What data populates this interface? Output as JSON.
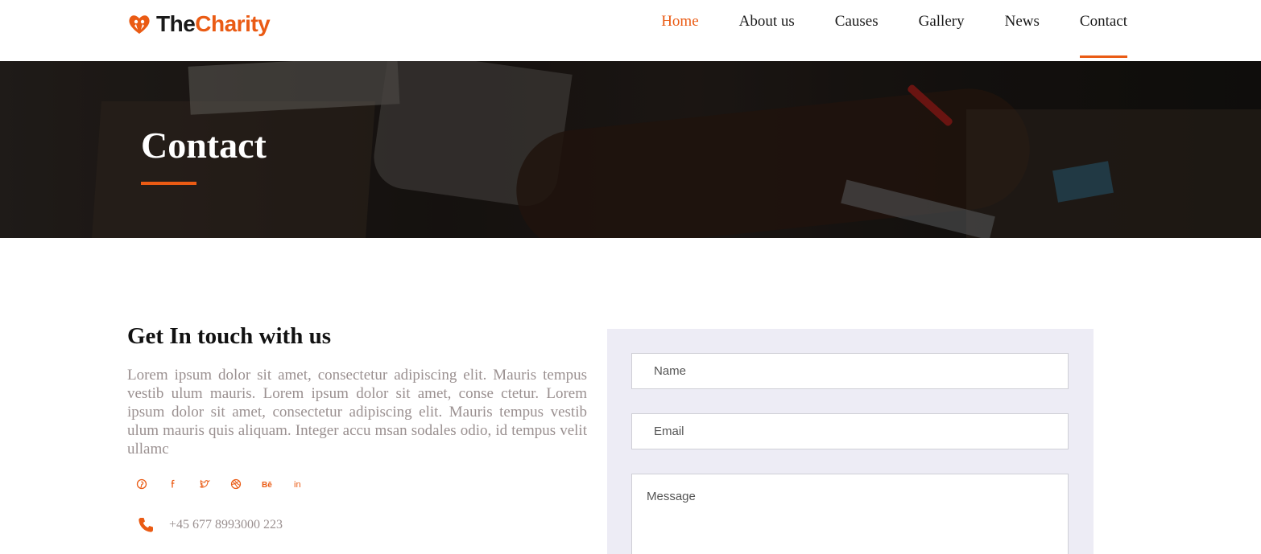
{
  "brand": {
    "part1": "The",
    "part2": "Charity"
  },
  "nav": [
    {
      "label": "Home"
    },
    {
      "label": "About us"
    },
    {
      "label": "Causes"
    },
    {
      "label": "Gallery"
    },
    {
      "label": "News"
    },
    {
      "label": "Contact"
    }
  ],
  "hero": {
    "title": "Contact"
  },
  "contact": {
    "title": "Get In touch with us",
    "text": "Lorem ipsum dolor sit amet, consectetur adipiscing elit. Mauris tempus vestib ulum mauris. Lorem ipsum dolor sit amet, conse ctetur. Lorem ipsum dolor sit amet, consectetur adipiscing elit. Mauris tempus vestib ulum mauris quis aliquam. Integer accu msan sodales odio, id tempus velit ullamc",
    "socials": [
      "pinterest-icon",
      "facebook-icon",
      "twitter-icon",
      "dribbble-icon",
      "behance-icon",
      "linkedin-icon"
    ],
    "phone": "+45 677 8993000 223"
  },
  "form": {
    "name_placeholder": "Name",
    "email_placeholder": "Email",
    "message_placeholder": "Message"
  },
  "colors": {
    "accent": "#ea5b14",
    "panel": "#edecf5",
    "muted_text": "#9a9090"
  }
}
